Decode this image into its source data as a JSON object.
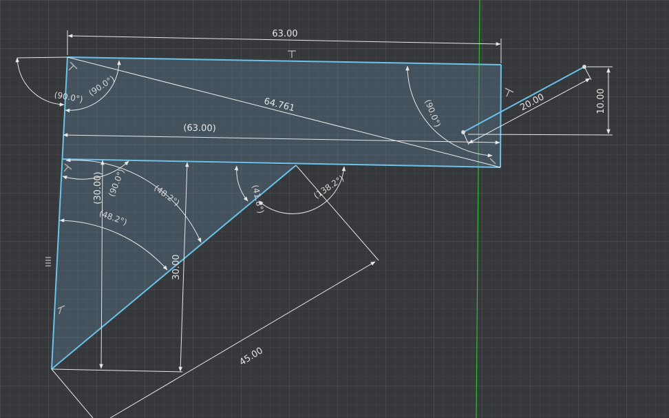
{
  "app": {
    "view": "sketch canvas"
  },
  "colors": {
    "background": "#36383b",
    "grid_minor": "#43464a",
    "grid_major": "#505358",
    "axis_vertical": "#2fbf2f",
    "profile_line": "#6cc3ea",
    "profile_fill": "#5d7d98",
    "dimension_line": "#e8e8e8",
    "text": "#e6e6e6"
  },
  "dimensions": {
    "top_width": "63.00",
    "reference_width": "(63.00)",
    "diagonal": "64.761",
    "small_line_length": "20.00",
    "small_line_height": "10.00",
    "left_height_reference": "(30.00)",
    "inner_height": "30.00",
    "hypotenuse": "45.00"
  },
  "angles": {
    "top_left_outer": "(90.0°)",
    "top_left_inner": "(90.0°)",
    "top_right": "(90.0°)",
    "triangle_top_left": "(90.0°)",
    "triangle_upper_arc": "(48.2°)",
    "triangle_lower_arc": "(48.2°)",
    "tip_left": "(41.8°)",
    "tip_right": "(138.2°)"
  },
  "icons": {
    "constraint_marker": "perpendicular-constraint-icon",
    "equal_marker": "equal-constraint-icon"
  }
}
